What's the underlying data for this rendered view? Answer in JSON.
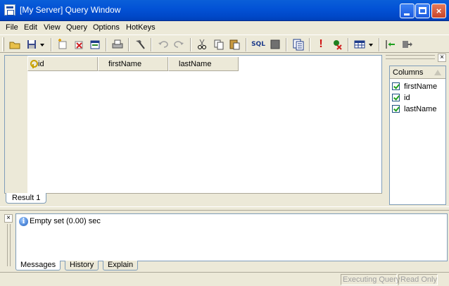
{
  "window": {
    "title": "[My Server] Query Window"
  },
  "menu": [
    "File",
    "Edit",
    "View",
    "Query",
    "Options",
    "HotKeys"
  ],
  "toolbar": {
    "icons": [
      "open-folder-icon",
      "save-icon",
      "dropdown-arrow-icon",
      "new-query-icon",
      "delete-icon",
      "window-icon",
      "print-icon",
      "hammer-icon",
      "undo-icon",
      "redo-icon",
      "cut-icon",
      "copy-icon",
      "paste-icon",
      "sql-icon",
      "stop-icon",
      "form-icon",
      "execute-icon",
      "cancel-query-icon",
      "grid-view-icon",
      "dropdown-arrow-icon",
      "import-icon",
      "export-icon"
    ],
    "sql_label": "SQL"
  },
  "grid": {
    "columns": [
      "id",
      "firstName",
      "lastName"
    ],
    "tabs": [
      "Result 1"
    ]
  },
  "columns_panel": {
    "header": "Columns",
    "items": [
      {
        "label": "firstName",
        "checked": true
      },
      {
        "label": "id",
        "checked": true
      },
      {
        "label": "lastName",
        "checked": true
      }
    ]
  },
  "messages": {
    "text": "Empty set (0.00) sec",
    "tabs": [
      "Messages",
      "History",
      "Explain"
    ]
  },
  "status": {
    "executing": "Executing Query",
    "readonly": "Read Only"
  },
  "close_glyph": "×"
}
